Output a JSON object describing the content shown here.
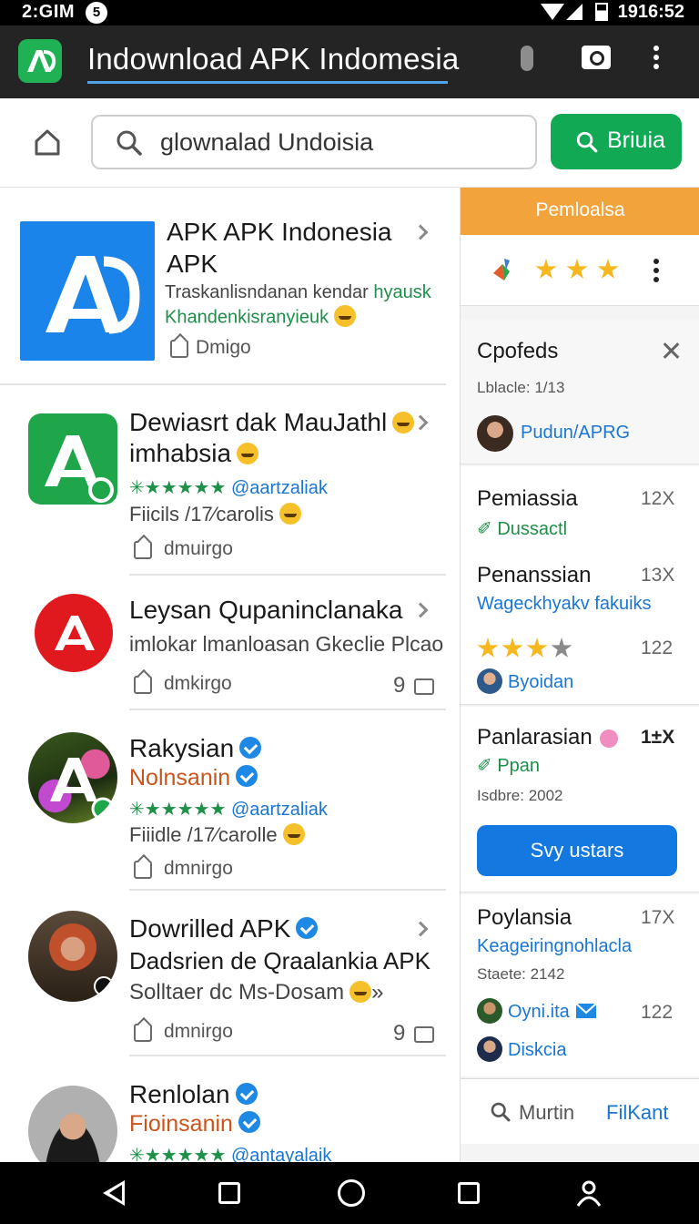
{
  "status_bar": {
    "time_left": "2:GIM",
    "badge": "5",
    "time_right": "1916:52"
  },
  "app_bar": {
    "title": "Indownload APK Indomesia"
  },
  "search": {
    "placeholder": "glownalad Undoisia",
    "value": "glownalad Undoisia",
    "button_label": "Briuia"
  },
  "list": [
    {
      "title_line1": "APK APK Indonesia",
      "title_line2": "APK",
      "desc_line1_black": "Traskanlisndanan kendar ",
      "desc_line1_green": "hyausk",
      "desc_line2": "Khandenkisranyieuk",
      "tag": "Dmigo"
    },
    {
      "title_line1": "Dewiasrt dak MauJathl",
      "title_line2": "imhabsia",
      "rating_text": "✳★★★★★",
      "rating_link": "@aartzaliak",
      "info": "Fiicils /17⁄carolis",
      "tag": "dmuirgo"
    },
    {
      "title_line1": "Leysan Qupaninclanaka",
      "desc": "imlokar lmanloasan Gkeclie Plcao",
      "tag": "dmkirgo",
      "count": "9"
    },
    {
      "title_line1": "Rakysian",
      "title_line2": "Nolnsanin",
      "rating_text": "✳★★★★★",
      "rating_link": "@aartzaliak",
      "info": "Fiiidle /17⁄carolle",
      "tag": "dmnirgo"
    },
    {
      "title_line1": "Dowrilled APK",
      "title_line2": "Dadsrien de Qraalankia APK",
      "info": "Solltaer dc Ms-Dosam",
      "info_suffix": "»",
      "tag": "dmnirgo",
      "count": "9"
    },
    {
      "title_line1": "Renlolan",
      "title_line2": "Fioinsanin",
      "rating_text": "✳★★★★★",
      "rating_link": "@antayalaik"
    }
  ],
  "right_panel": {
    "promo": {
      "header": "Pemloalsa",
      "stars": 3
    },
    "profile_card": {
      "title": "Cpofeds",
      "subtitle": "Lblacle: 1/13",
      "user": "Pudun/APRG"
    },
    "entries": [
      {
        "title": "Pemiassia",
        "count": "12X",
        "sub": "Dussactl",
        "sub_icon": "leaf-icon"
      },
      {
        "title": "Penanssian",
        "count": "13X",
        "sub": "Wageckhyakv fakuiks",
        "rating": 3,
        "rating_count": "122",
        "user": "Byoidan"
      },
      {
        "title": "Panlarasian",
        "count": "1±X",
        "sub": "Ppan",
        "small": "Isdbre: 2002",
        "button": "Svy ustars"
      },
      {
        "title": "Poylansia",
        "count": "17X",
        "sub": "Keageiringnohlacla",
        "small": "Staete: 2142",
        "user1": "Oyni.ita",
        "user1_count": "122",
        "user2": "Diskcia"
      }
    ],
    "footer": {
      "search_label": "Murtin",
      "link": "FilKant"
    }
  },
  "colors": {
    "green": "#12a955",
    "blue": "#1976d2",
    "orange": "#f2a33c",
    "red": "#e0191e",
    "appbar": "#242424"
  }
}
